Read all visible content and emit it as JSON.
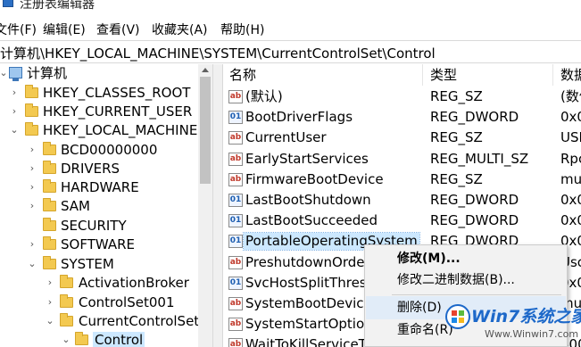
{
  "window": {
    "title": "注册表编辑器"
  },
  "menu": [
    {
      "label": "文件(F)"
    },
    {
      "label": "编辑(E)"
    },
    {
      "label": "查看(V)"
    },
    {
      "label": "收藏夹(A)"
    },
    {
      "label": "帮助(H)"
    }
  ],
  "address": {
    "path": "计算机\\HKEY_LOCAL_MACHINE\\SYSTEM\\CurrentControlSet\\Control"
  },
  "tree": {
    "root": "计算机",
    "items": [
      {
        "label": "HKEY_CLASSES_ROOT"
      },
      {
        "label": "HKEY_CURRENT_USER"
      },
      {
        "label": "HKEY_LOCAL_MACHINE"
      },
      {
        "label": "BCD00000000"
      },
      {
        "label": "DRIVERS"
      },
      {
        "label": "HARDWARE"
      },
      {
        "label": "SAM"
      },
      {
        "label": "SECURITY"
      },
      {
        "label": "SOFTWARE"
      },
      {
        "label": "SYSTEM"
      },
      {
        "label": "ActivationBroker"
      },
      {
        "label": "ControlSet001"
      },
      {
        "label": "CurrentControlSet"
      },
      {
        "label": "Control"
      }
    ]
  },
  "list": {
    "columns": {
      "name": "名称",
      "type": "类型",
      "data": "数据"
    },
    "rows": [
      {
        "name": "(默认)",
        "type": "REG_SZ",
        "data": "(数值"
      },
      {
        "name": "BootDriverFlags",
        "type": "REG_DWORD",
        "data": "0x0"
      },
      {
        "name": "CurrentUser",
        "type": "REG_SZ",
        "data": "USE"
      },
      {
        "name": "EarlyStartServices",
        "type": "REG_MULTI_SZ",
        "data": "Rpc"
      },
      {
        "name": "FirmwareBootDevice",
        "type": "REG_SZ",
        "data": "mul"
      },
      {
        "name": "LastBootShutdown",
        "type": "REG_DWORD",
        "data": "0x0"
      },
      {
        "name": "LastBootSucceeded",
        "type": "REG_DWORD",
        "data": "0x0"
      },
      {
        "name": "PortableOperatingSystem",
        "type": "REG_DWORD",
        "data": "0x0"
      },
      {
        "name": "PreshutdownOrder",
        "type": "",
        "data": "Usc"
      },
      {
        "name": "SvcHostSplitThresh",
        "type": "",
        "data": "0x0"
      },
      {
        "name": "SystemBootDevice",
        "type": "",
        "data": "mul"
      },
      {
        "name": "SystemStartOption",
        "type": "",
        "data": ""
      },
      {
        "name": "WaitToKillServiceTimeout",
        "type": "REG_SZ",
        "data": "500"
      }
    ]
  },
  "context_menu": {
    "items": [
      {
        "label": "修改(M)..."
      },
      {
        "label": "修改二进制数据(B)..."
      },
      {
        "label": "删除(D)"
      },
      {
        "label": "重命名(R)"
      }
    ]
  },
  "watermark": {
    "title": "Win7系统之家",
    "url": "Www.Winwin7.com"
  }
}
